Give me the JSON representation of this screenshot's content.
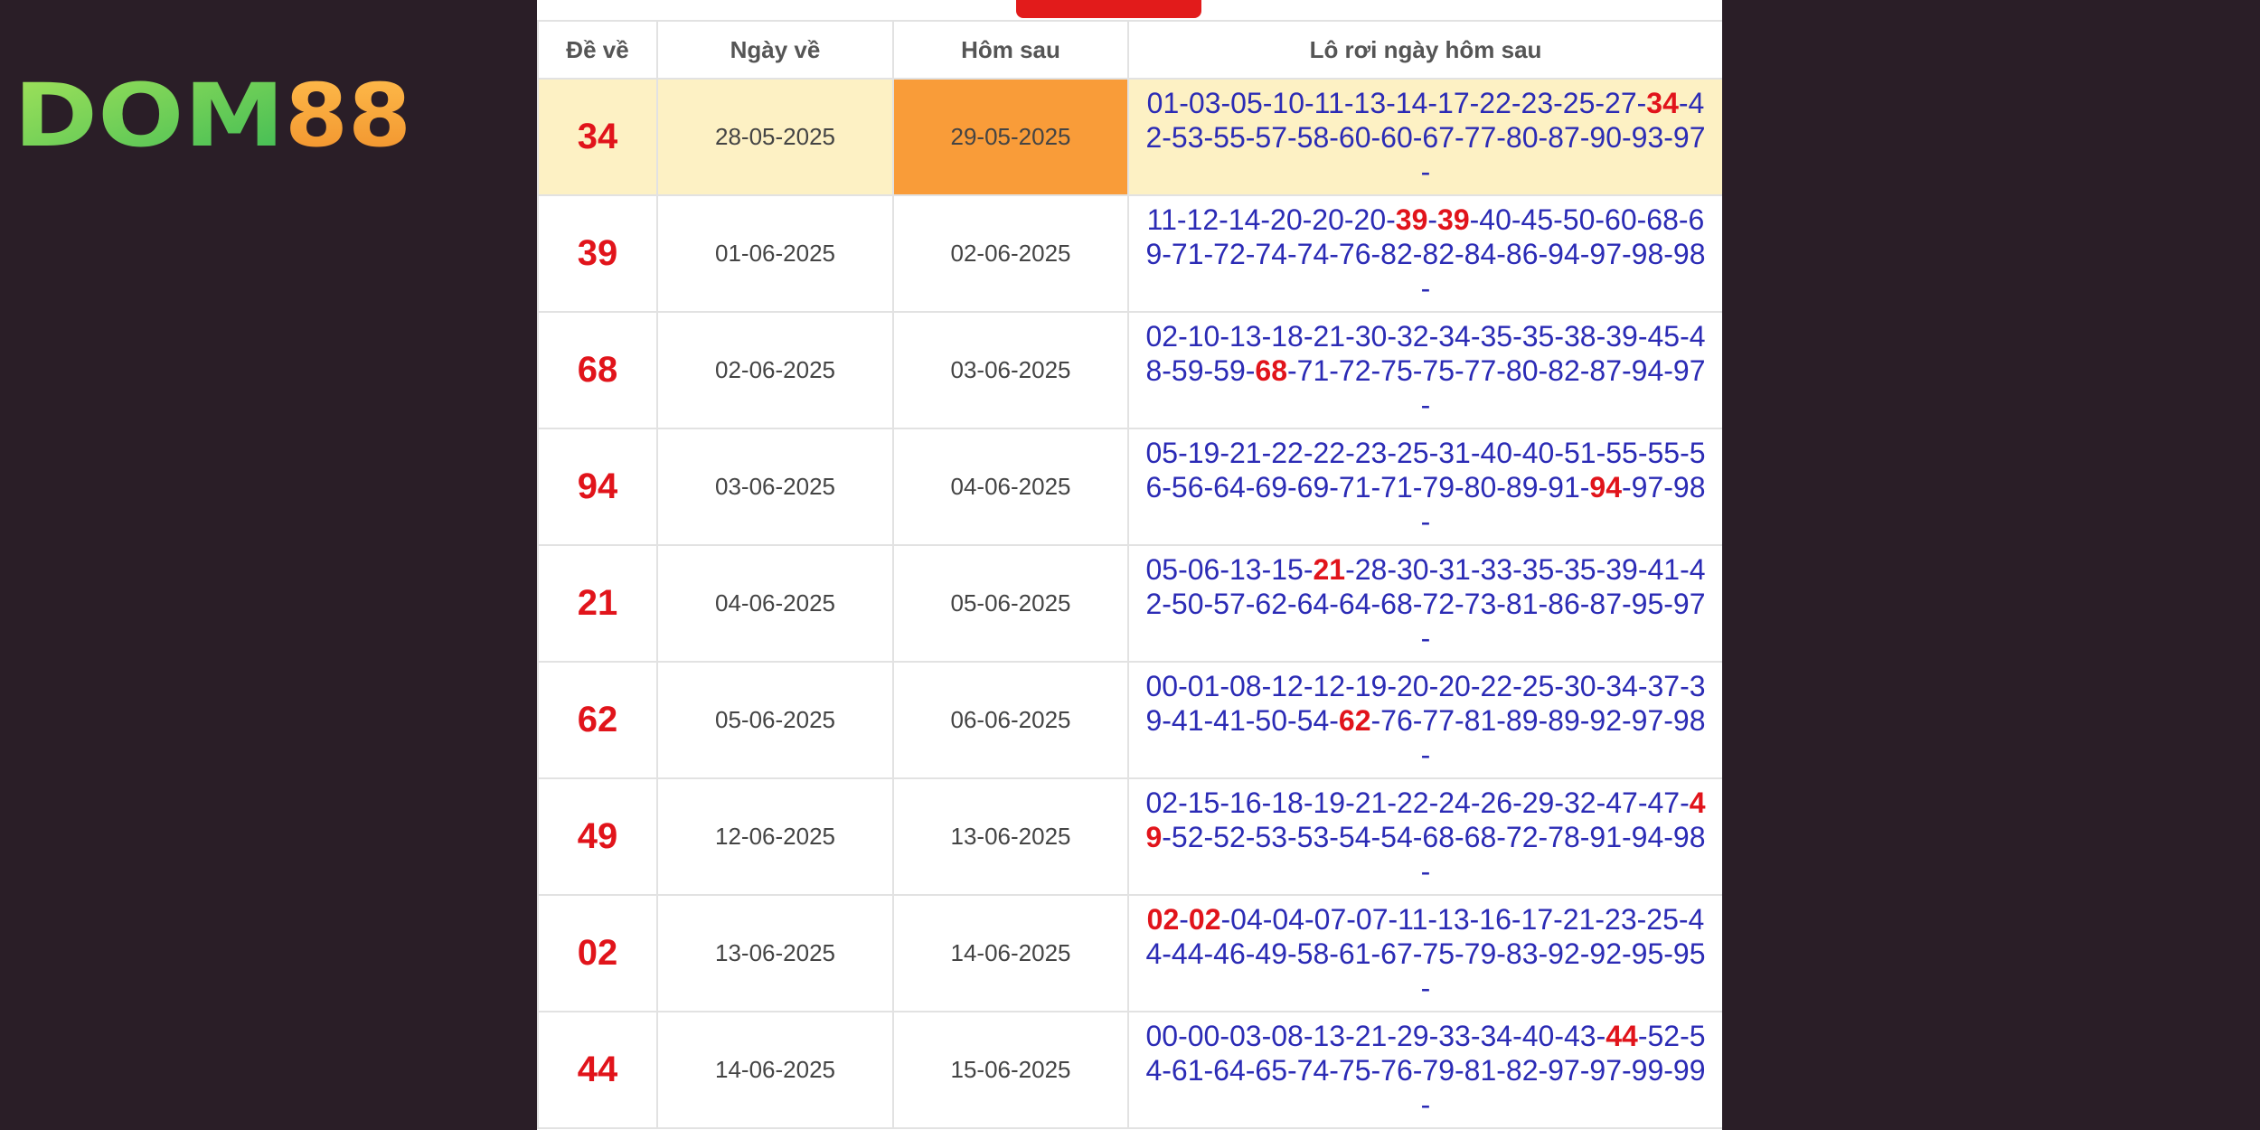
{
  "brand": {
    "logo_text": "DOM88",
    "logo_part1": "DOM",
    "logo_part2": "88"
  },
  "table": {
    "headers": [
      "Đề về",
      "Ngày về",
      "Hôm sau",
      "Lô rơi ngày hôm sau"
    ],
    "rows": [
      {
        "de_ve": "34",
        "ngay_ve": "28-05-2025",
        "hom_sau": "29-05-2025",
        "highlight": true,
        "lo": [
          "01",
          "03",
          "05",
          "10",
          "11",
          "13",
          "14",
          "17",
          "22",
          "23",
          "25",
          "27",
          "34",
          "42",
          "53",
          "55",
          "57",
          "58",
          "60",
          "60",
          "67",
          "77",
          "80",
          "87",
          "90",
          "93",
          "97"
        ]
      },
      {
        "de_ve": "39",
        "ngay_ve": "01-06-2025",
        "hom_sau": "02-06-2025",
        "lo": [
          "11",
          "12",
          "14",
          "20",
          "20",
          "20",
          "39",
          "39",
          "40",
          "45",
          "50",
          "60",
          "68",
          "69",
          "71",
          "72",
          "74",
          "74",
          "76",
          "82",
          "82",
          "84",
          "86",
          "94",
          "97",
          "98",
          "98"
        ]
      },
      {
        "de_ve": "68",
        "ngay_ve": "02-06-2025",
        "hom_sau": "03-06-2025",
        "lo": [
          "02",
          "10",
          "13",
          "18",
          "21",
          "30",
          "32",
          "34",
          "35",
          "35",
          "38",
          "39",
          "45",
          "48",
          "59",
          "59",
          "68",
          "71",
          "72",
          "75",
          "75",
          "77",
          "80",
          "82",
          "87",
          "94",
          "97"
        ]
      },
      {
        "de_ve": "94",
        "ngay_ve": "03-06-2025",
        "hom_sau": "04-06-2025",
        "lo": [
          "05",
          "19",
          "21",
          "22",
          "22",
          "23",
          "25",
          "31",
          "40",
          "40",
          "51",
          "55",
          "55",
          "56",
          "56",
          "64",
          "69",
          "69",
          "71",
          "71",
          "79",
          "80",
          "89",
          "91",
          "94",
          "97",
          "98"
        ]
      },
      {
        "de_ve": "21",
        "ngay_ve": "04-06-2025",
        "hom_sau": "05-06-2025",
        "lo": [
          "05",
          "06",
          "13",
          "15",
          "21",
          "28",
          "30",
          "31",
          "33",
          "35",
          "35",
          "39",
          "41",
          "42",
          "50",
          "57",
          "62",
          "64",
          "64",
          "68",
          "72",
          "73",
          "81",
          "86",
          "87",
          "95",
          "97"
        ]
      },
      {
        "de_ve": "62",
        "ngay_ve": "05-06-2025",
        "hom_sau": "06-06-2025",
        "lo": [
          "00",
          "01",
          "08",
          "12",
          "12",
          "19",
          "20",
          "20",
          "22",
          "25",
          "30",
          "34",
          "37",
          "39",
          "41",
          "41",
          "50",
          "54",
          "62",
          "76",
          "77",
          "81",
          "89",
          "89",
          "92",
          "97",
          "98"
        ]
      },
      {
        "de_ve": "49",
        "ngay_ve": "12-06-2025",
        "hom_sau": "13-06-2025",
        "lo": [
          "02",
          "15",
          "16",
          "18",
          "19",
          "21",
          "22",
          "24",
          "26",
          "29",
          "32",
          "47",
          "47",
          "49",
          "52",
          "52",
          "53",
          "53",
          "54",
          "54",
          "68",
          "68",
          "72",
          "78",
          "91",
          "94",
          "98"
        ]
      },
      {
        "de_ve": "02",
        "ngay_ve": "13-06-2025",
        "hom_sau": "14-06-2025",
        "lo": [
          "02",
          "02",
          "04",
          "04",
          "07",
          "07",
          "11",
          "13",
          "16",
          "17",
          "21",
          "23",
          "25",
          "44",
          "44",
          "46",
          "49",
          "58",
          "61",
          "67",
          "75",
          "79",
          "83",
          "92",
          "92",
          "95",
          "95"
        ]
      },
      {
        "de_ve": "44",
        "ngay_ve": "14-06-2025",
        "hom_sau": "15-06-2025",
        "lo": [
          "00",
          "00",
          "03",
          "08",
          "13",
          "21",
          "29",
          "33",
          "34",
          "40",
          "43",
          "44",
          "52",
          "54",
          "61",
          "64",
          "65",
          "74",
          "75",
          "76",
          "79",
          "81",
          "82",
          "97",
          "97",
          "99",
          "99"
        ]
      }
    ]
  },
  "colors": {
    "page_bg": "#2a1e27",
    "logo_green": "#7cd848",
    "logo_orange": "#f5a43a",
    "number_blue": "#2b2bb5",
    "hit_red": "#e1141b",
    "highlight_row": "#fdf1c4",
    "highlight_cell": "#f99c39",
    "top_tab_red": "#e21b1b"
  }
}
